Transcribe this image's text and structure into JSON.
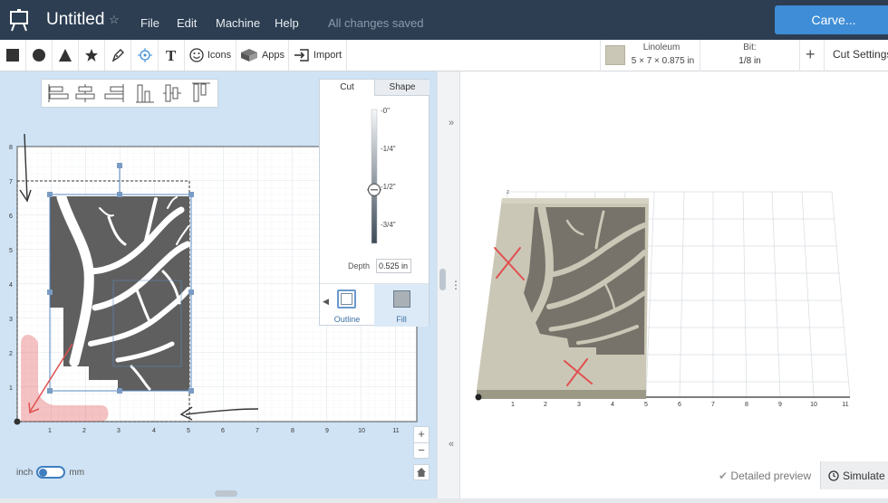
{
  "header": {
    "title": "Untitled",
    "menu": [
      "File",
      "Edit",
      "Machine",
      "Help"
    ],
    "status": "All changes saved",
    "carve_label": "Carve..."
  },
  "toolbar": {
    "icons_label": "Icons",
    "apps_label": "Apps",
    "import_label": "Import",
    "material_name": "Linoleum",
    "material_dims": "5 × 7 × 0.875 in",
    "bit_label": "Bit:",
    "bit_value": "1/8 in",
    "add_label": "+",
    "cut_settings_label": "Cut Settings"
  },
  "cut_panel": {
    "tab_cut": "Cut",
    "tab_shape": "Shape",
    "depth_ticks": [
      "-0\"",
      "-1/4\"",
      "-1/2\"",
      "-3/4\""
    ],
    "depth_label": "Depth",
    "depth_value": "0.525 in",
    "outline_label": "Outline",
    "fill_label": "Fill",
    "depth_fraction": 0.6
  },
  "canvas": {
    "x_ticks": [
      "1",
      "2",
      "3",
      "4",
      "5",
      "6",
      "7",
      "8",
      "9",
      "10",
      "11"
    ],
    "y_ticks": [
      "1",
      "2",
      "3",
      "4",
      "5",
      "6",
      "7",
      "8"
    ]
  },
  "zoom": {
    "in_label": "+",
    "out_label": "−"
  },
  "units": {
    "inch_label": "inch",
    "mm_label": "mm"
  },
  "preview": {
    "x_ticks": [
      "1",
      "2",
      "3",
      "4",
      "5",
      "6",
      "7",
      "8",
      "9",
      "10",
      "11"
    ],
    "detailed_label": "Detailed preview",
    "simulate_label": "Simulate"
  },
  "colors": {
    "topbar": "#2d3e52",
    "carve": "#3f8dd6",
    "design_bg": "#cfe3f5",
    "artwork": "#5f5f5f",
    "material": "#cbc7b6",
    "annotation_red": "#e05050"
  }
}
